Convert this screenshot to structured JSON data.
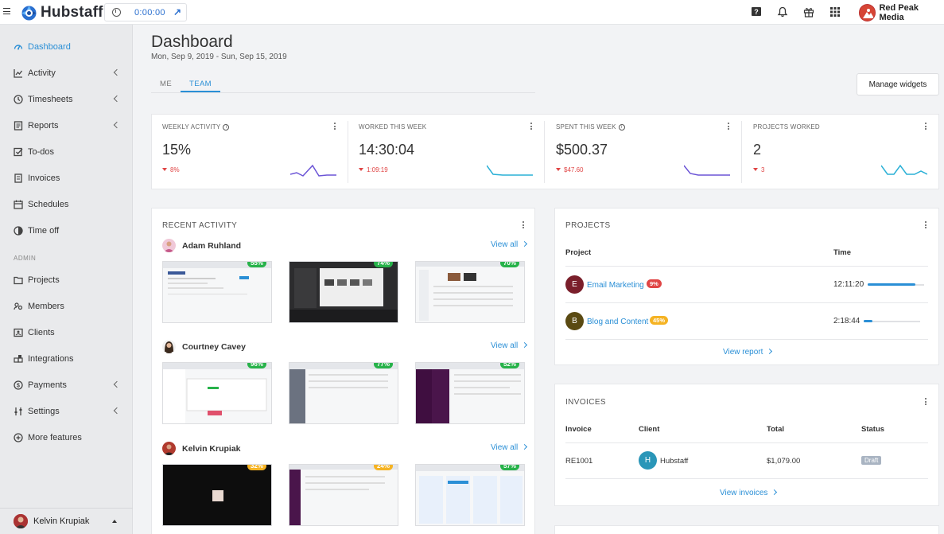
{
  "topbar": {
    "brand": "Hubstaff",
    "timer": "0:00:00",
    "org_name": "Red Peak Media"
  },
  "sidebar": {
    "items": [
      {
        "label": "Dashboard",
        "icon": "dashboard-icon",
        "active": true
      },
      {
        "label": "Activity",
        "icon": "activity-icon"
      },
      {
        "label": "Timesheets",
        "icon": "clock-icon"
      },
      {
        "label": "Reports",
        "icon": "reports-icon"
      },
      {
        "label": "To-dos",
        "icon": "checkbox-icon"
      },
      {
        "label": "Invoices",
        "icon": "invoice-icon"
      },
      {
        "label": "Schedules",
        "icon": "calendar-icon"
      },
      {
        "label": "Time off",
        "icon": "pie-icon"
      }
    ],
    "admin_label": "ADMIN",
    "admin_items": [
      {
        "label": "Projects",
        "icon": "folder-icon"
      },
      {
        "label": "Members",
        "icon": "members-icon"
      },
      {
        "label": "Clients",
        "icon": "clients-icon"
      },
      {
        "label": "Integrations",
        "icon": "integrations-icon"
      },
      {
        "label": "Payments",
        "icon": "payments-icon"
      },
      {
        "label": "Settings",
        "icon": "settings-icon"
      },
      {
        "label": "More features",
        "icon": "plus-circle-icon"
      }
    ],
    "user_name": "Kelvin Krupiak"
  },
  "header": {
    "title": "Dashboard",
    "date_range": "Mon, Sep 9, 2019 - Sun, Sep 15, 2019",
    "tabs": [
      "ME",
      "TEAM"
    ],
    "manage_widgets": "Manage widgets"
  },
  "stats": [
    {
      "label": "WEEKLY ACTIVITY",
      "value": "15%",
      "delta": "8%"
    },
    {
      "label": "WORKED THIS WEEK",
      "value": "14:30:04",
      "delta": "1:09:19"
    },
    {
      "label": "SPENT THIS WEEK",
      "value": "$500.37",
      "delta": "$47.60"
    },
    {
      "label": "PROJECTS WORKED",
      "value": "2",
      "delta": "3"
    }
  ],
  "recent_activity": {
    "title": "RECENT ACTIVITY",
    "view_all": "View all",
    "people": [
      {
        "name": "Adam Ruhland",
        "shots": [
          "55%",
          "74%",
          "70%"
        ]
      },
      {
        "name": "Courtney Cavey",
        "shots": [
          "96%",
          "77%",
          "52%"
        ]
      },
      {
        "name": "Kelvin Krupiak",
        "shots": [
          "32%",
          "24%",
          "57%"
        ]
      }
    ]
  },
  "projects": {
    "title": "PROJECTS",
    "col_project": "Project",
    "col_time": "Time",
    "rows": [
      {
        "initial": "E",
        "name": "Email Marketing",
        "badge": "9%",
        "time": "12:11:20",
        "progress": 0.85,
        "color": "#7a1f2b",
        "badge_color": "#e04545"
      },
      {
        "initial": "B",
        "name": "Blog and Content",
        "badge": "45%",
        "time": "2:18:44",
        "progress": 0.16,
        "color": "#5a4a12",
        "badge_color": "#f5b323"
      }
    ],
    "view_report": "View report"
  },
  "invoices": {
    "title": "INVOICES",
    "cols": [
      "Invoice",
      "Client",
      "Total",
      "Status"
    ],
    "rows": [
      {
        "invoice": "RE1001",
        "client_initial": "H",
        "client": "Hubstaff",
        "total": "$1,079.00",
        "status": "Draft"
      }
    ],
    "view_invoices": "View invoices"
  },
  "colors": {
    "accent": "#2a8fd6",
    "danger": "#e04545",
    "success": "#27b24a",
    "warning": "#f5b323"
  }
}
